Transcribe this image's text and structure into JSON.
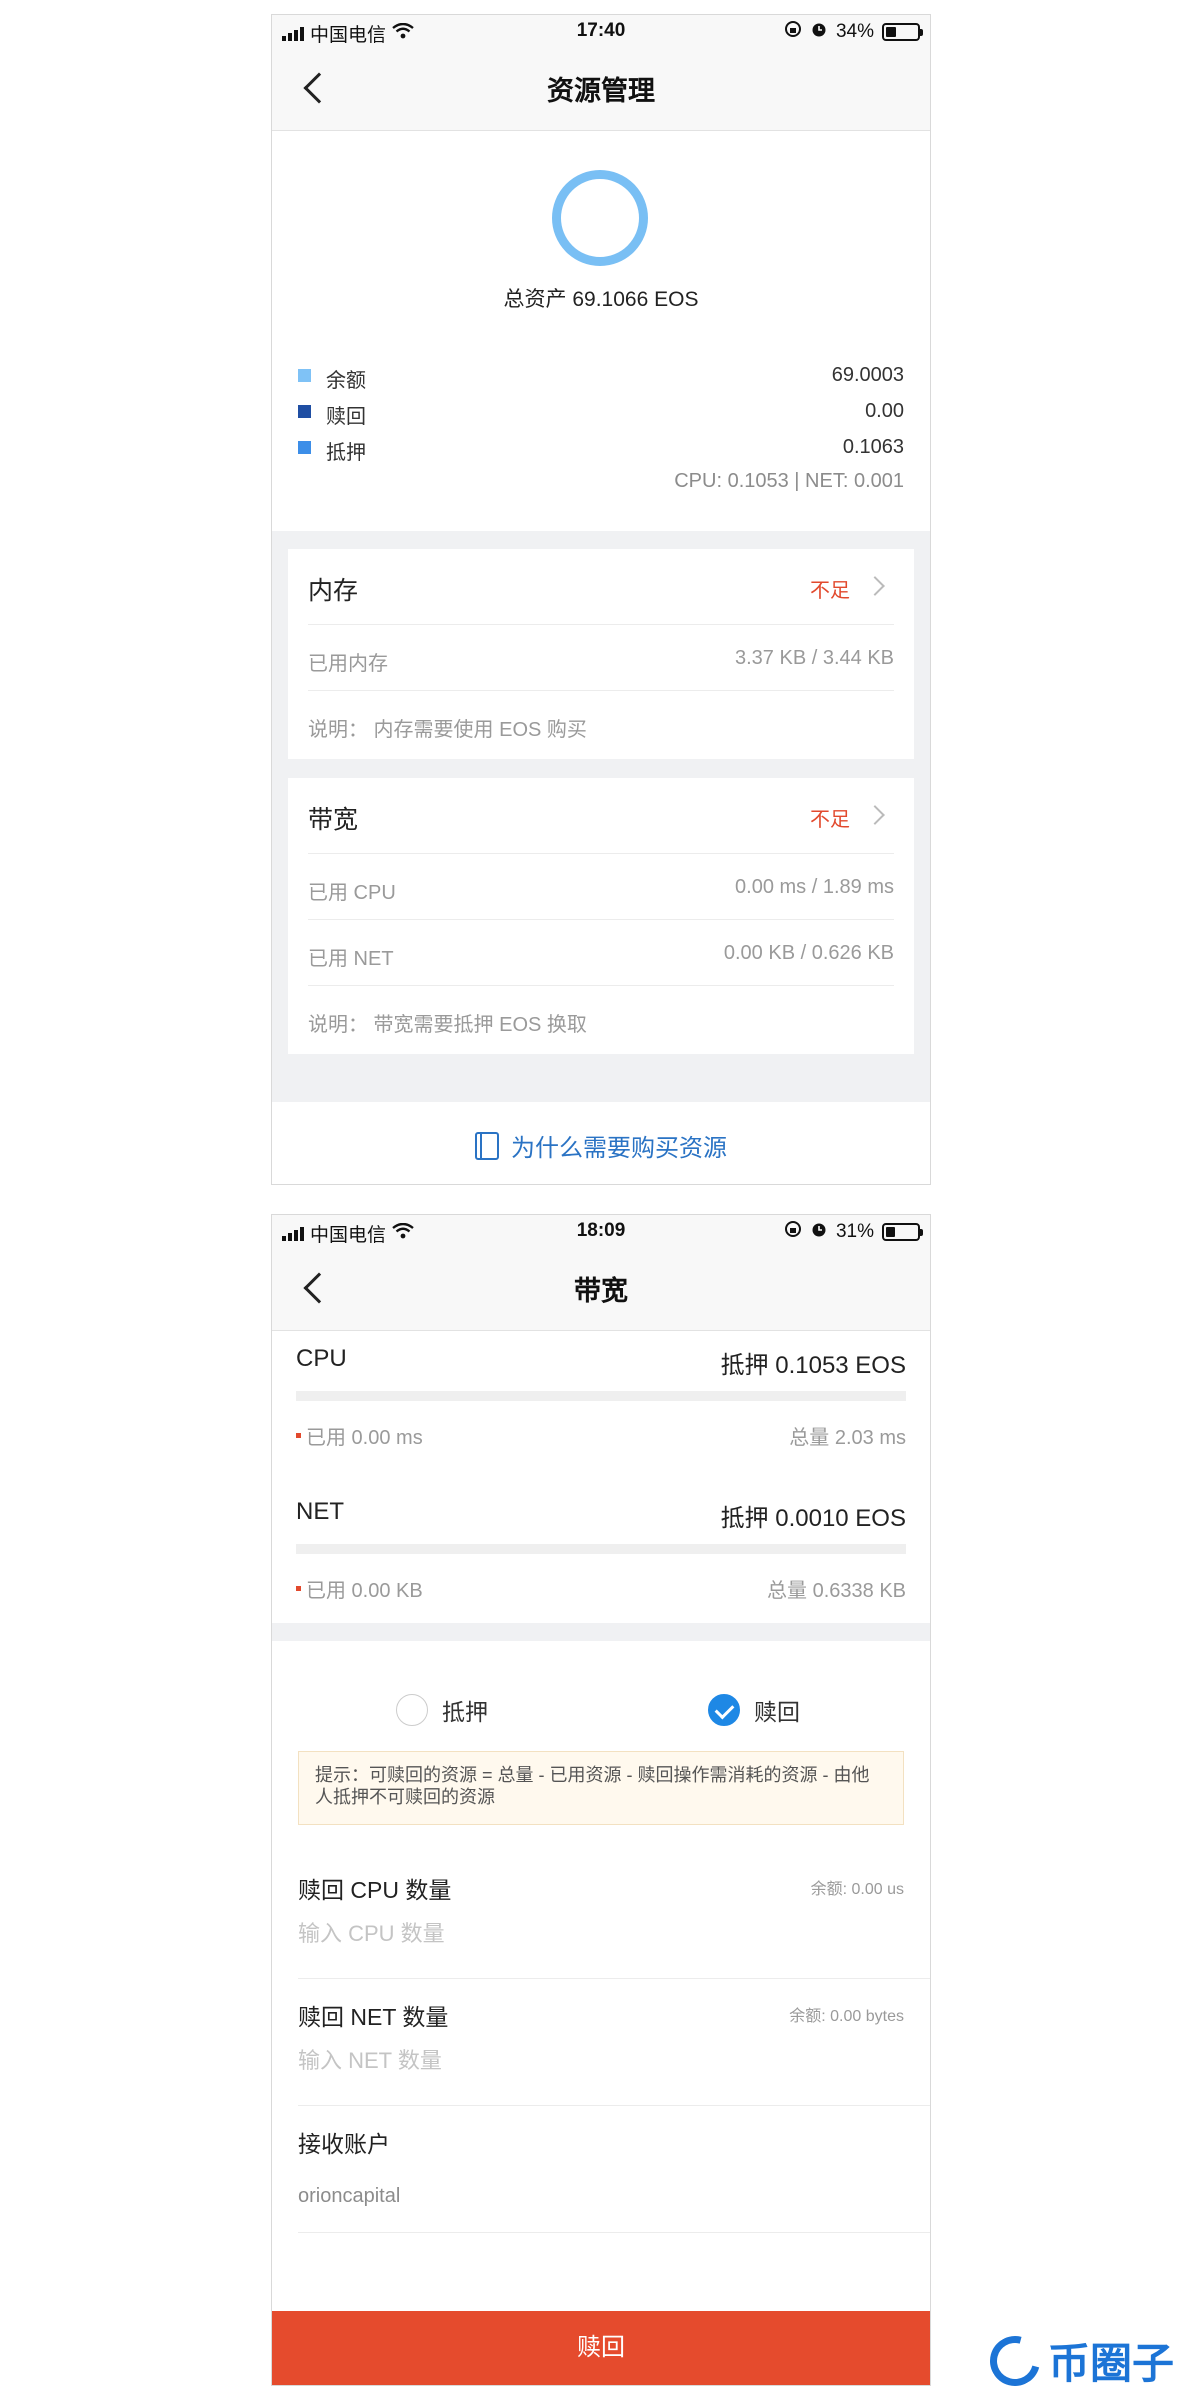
{
  "screen1": {
    "status": {
      "carrier": "中国电信",
      "time": "17:40",
      "battery": "34%",
      "battery_level": 0.34
    },
    "nav_title": "资源管理",
    "total_assets": "总资产 69.1066 EOS",
    "legend": [
      {
        "label": "余额",
        "value": "69.0003",
        "color": "#7fc2f6"
      },
      {
        "label": "赎回",
        "value": "0.00",
        "color": "#1f4ea3"
      },
      {
        "label": "抵押",
        "value": "0.1063",
        "color": "#3c8ee8"
      }
    ],
    "cpu_net_summary": "CPU: 0.1053 | NET: 0.001",
    "memory_card": {
      "title": "内存",
      "status": "不足",
      "used_label": "已用内存",
      "used_value": "3.37 KB / 3.44 KB",
      "note": "说明： 内存需要使用 EOS 购买"
    },
    "bandwidth_card": {
      "title": "带宽",
      "status": "不足",
      "cpu_label": "已用 CPU",
      "cpu_value": "0.00 ms / 1.89 ms",
      "net_label": "已用 NET",
      "net_value": "0.00 KB / 0.626 KB",
      "note": "说明： 带宽需要抵押 EOS 换取"
    },
    "why_link": "为什么需要购买资源"
  },
  "screen2": {
    "status": {
      "carrier": "中国电信",
      "time": "18:09",
      "battery": "31%",
      "battery_level": 0.31
    },
    "nav_title": "带宽",
    "cpu": {
      "title": "CPU",
      "stake": "抵押 0.1053 EOS",
      "used": "已用 0.00 ms",
      "total": "总量 2.03 ms",
      "usage": 0
    },
    "net": {
      "title": "NET",
      "stake": "抵押 0.0010 EOS",
      "used": "已用 0.00 KB",
      "total": "总量 0.6338 KB",
      "usage": 0
    },
    "options": {
      "stake": "抵押",
      "redeem": "赎回",
      "selected": "赎回"
    },
    "tip": "提示：可赎回的资源 = 总量 - 已用资源 - 赎回操作需消耗的资源 - 由他人抵押不可赎回的资源",
    "cpu_field": {
      "label": "赎回 CPU 数量",
      "balance": "余额: 0.00 us",
      "placeholder": "输入 CPU 数量"
    },
    "net_field": {
      "label": "赎回 NET 数量",
      "balance": "余额: 0.00 bytes",
      "placeholder": "输入 NET 数量"
    },
    "account_field": {
      "label": "接收账户",
      "value": "orioncapital"
    },
    "submit": "赎回"
  },
  "watermark": "币圈子"
}
